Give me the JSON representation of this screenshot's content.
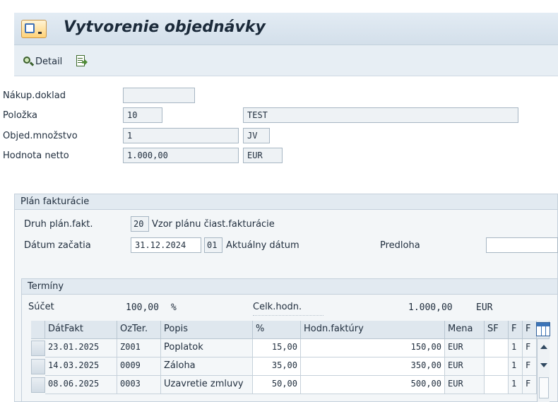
{
  "header": {
    "title": "Vytvorenie objednávky"
  },
  "toolbar": {
    "detail_label": "Detail"
  },
  "fields": {
    "nakup_doklad": {
      "label": "Nákup.doklad",
      "value": ""
    },
    "polozka": {
      "label": "Položka",
      "value": "10",
      "text": "TEST"
    },
    "objed_mnozstvo": {
      "label": "Objed.množstvo",
      "value": "1",
      "unit": "JV"
    },
    "hodnota_netto": {
      "label": "Hodnota netto",
      "value": "1.000,00",
      "currency": "EUR"
    }
  },
  "plan": {
    "title": "Plán fakturácie",
    "druh_label": "Druh plán.fakt.",
    "druh_code": "20",
    "druh_text": "Vzor plánu čiast.fakturácie",
    "datum_label": "Dátum začatia",
    "datum_value": "31.12.2024",
    "datum_code": "01",
    "datum_text": "Aktuálny dátum",
    "predloha_label": "Predloha",
    "predloha_value": ""
  },
  "terminy": {
    "title": "Termíny",
    "sucet_label": "Súčet",
    "sucet_value": "100,00",
    "sucet_unit": "%",
    "celk_label": "Celk.hodn.",
    "celk_value": "1.000,00",
    "celk_currency": "EUR",
    "columns": [
      "DátFakt",
      "OzTer.",
      "Popis",
      "%",
      "Hodn.faktúry",
      "Mena",
      "SF",
      "F",
      "F"
    ],
    "rows": [
      {
        "date": "23.01.2025",
        "code": "Z001",
        "desc": "Poplatok",
        "pct": "15,00",
        "amount": "150,00",
        "currency": "EUR",
        "sf": "",
        "f": "1",
        "f2": "F"
      },
      {
        "date": "14.03.2025",
        "code": "0009",
        "desc": "Záloha",
        "pct": "35,00",
        "amount": "350,00",
        "currency": "EUR",
        "sf": "",
        "f": "1",
        "f2": "F"
      },
      {
        "date": "08.06.2025",
        "code": "0003",
        "desc": "Uzavretie zmluvy",
        "pct": "50,00",
        "amount": "500,00",
        "currency": "EUR",
        "sf": "",
        "f": "1",
        "f2": "F"
      }
    ]
  },
  "icons": {
    "title": "sap-menu-icon",
    "detail": "detail-magnifier-icon",
    "export": "export-icon",
    "config": "table-settings-icon"
  }
}
